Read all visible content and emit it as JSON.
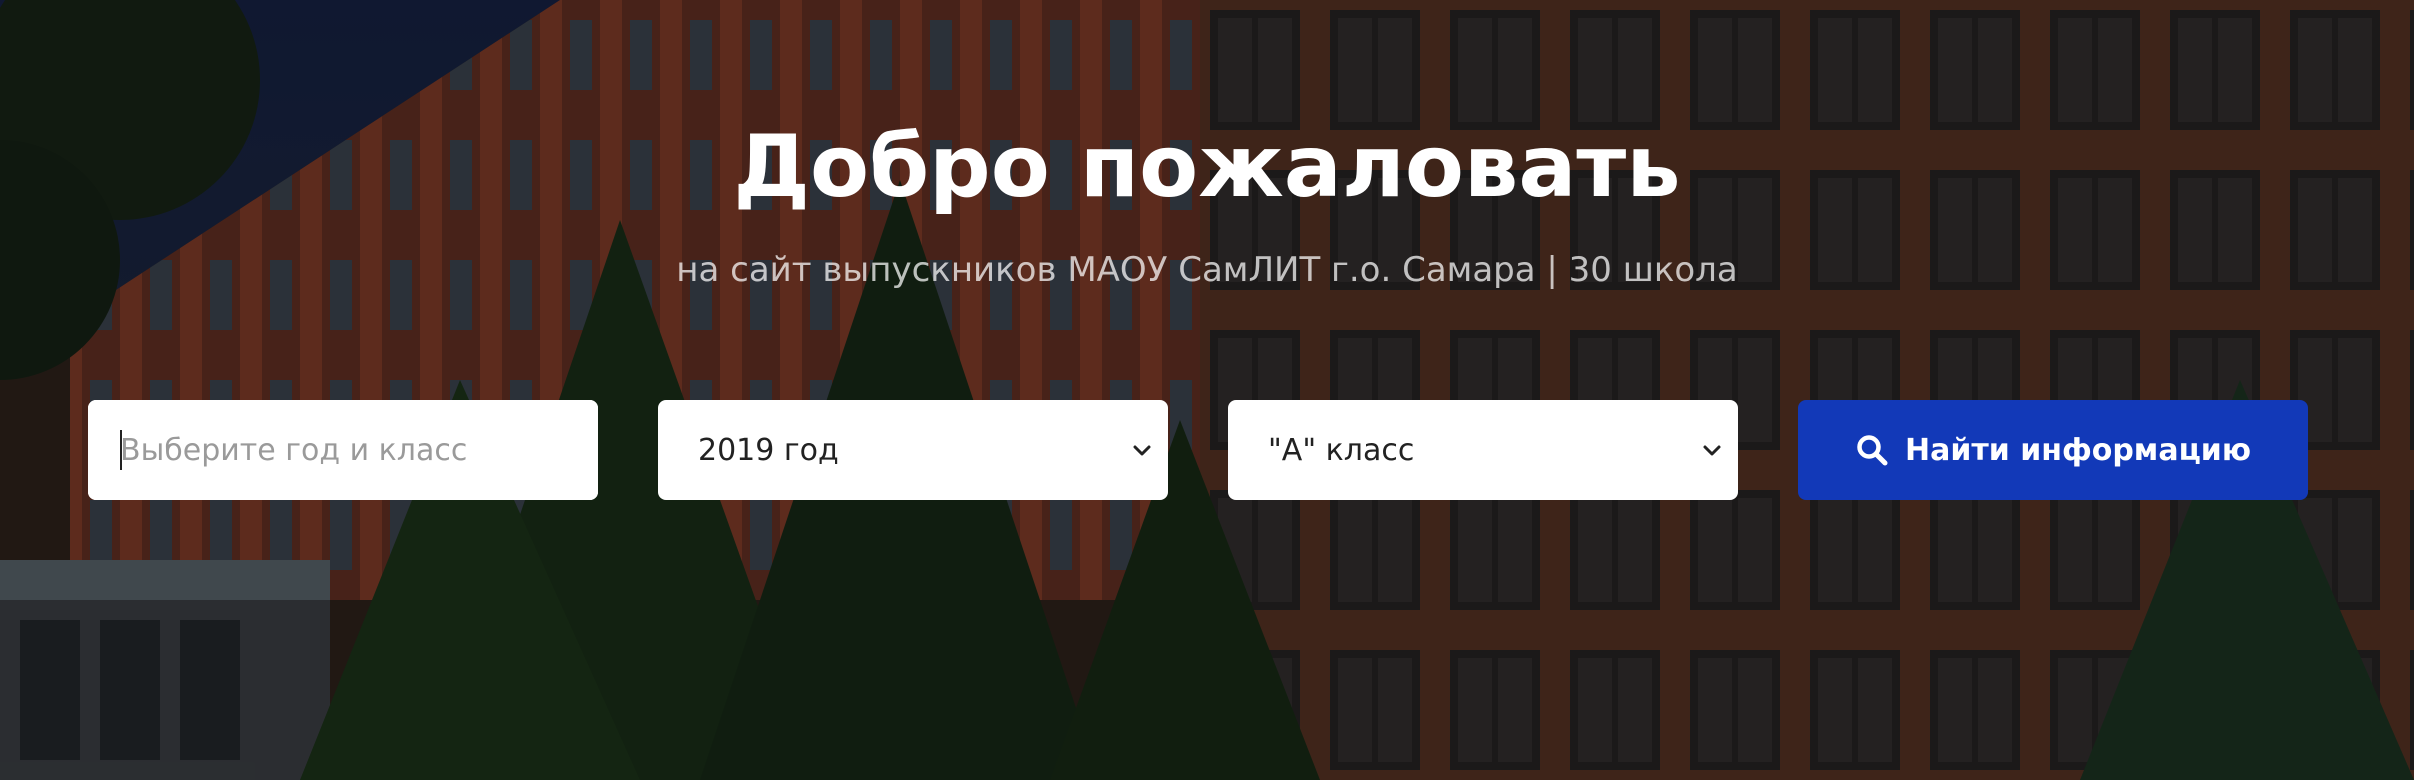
{
  "hero": {
    "title": "Добро пожаловать",
    "subtitle": "на сайт выпускников МАОУ СамЛИТ г.о. Самара | 30 школа"
  },
  "search_form": {
    "query_placeholder": "Выберите год и класс",
    "query_value": "",
    "year_select": {
      "selected": "2019 год",
      "icon": "chevron-down-icon"
    },
    "class_select": {
      "selected": "\"А\" класс",
      "icon": "chevron-down-icon"
    },
    "submit": {
      "label": "Найти информацию",
      "icon": "search-icon",
      "color": "#1239b8"
    }
  },
  "colors": {
    "overlay": "rgba(0,0,0,0.42)",
    "text": "#ffffff",
    "button": "#1239b8"
  }
}
